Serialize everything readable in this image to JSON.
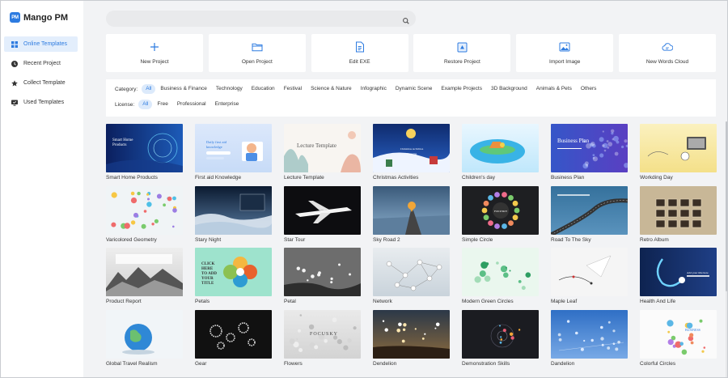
{
  "app": {
    "logo_badge": "PM",
    "name": "Mango PM",
    "accent": "#2d7be0"
  },
  "sidebar": {
    "items": [
      {
        "label": "Online Templates",
        "icon": "grid-icon",
        "active": true
      },
      {
        "label": "Recent Project",
        "icon": "clock-icon",
        "active": false
      },
      {
        "label": "Collect Template",
        "icon": "star-icon",
        "active": false
      },
      {
        "label": "Used Templates",
        "icon": "monitor-icon",
        "active": false
      }
    ]
  },
  "search": {
    "placeholder": "",
    "icon": "search-icon"
  },
  "actions": [
    {
      "label": "New Project",
      "icon": "plus-icon"
    },
    {
      "label": "Open Project",
      "icon": "folder-icon"
    },
    {
      "label": "Edit EXE",
      "icon": "exe-file-icon"
    },
    {
      "label": "Restore Project",
      "icon": "restore-icon"
    },
    {
      "label": "Import Image",
      "icon": "image-icon"
    },
    {
      "label": "New Words Cloud",
      "icon": "cloud-icon"
    }
  ],
  "filters": {
    "category_label": "Category:",
    "categories": [
      "All",
      "Business & Finance",
      "Technology",
      "Education",
      "Festival",
      "Science & Nature",
      "Infographic",
      "Dynamic Scene",
      "Example Projects",
      "3D Background",
      "Animals & Pets",
      "Others"
    ],
    "category_selected": "All",
    "license_label": "License:",
    "licenses": [
      "All",
      "Free",
      "Professional",
      "Enterprise"
    ],
    "license_selected": "All"
  },
  "templates": [
    {
      "name": "Smart Home Products",
      "style": "smart-home",
      "caption": "Smart Home Products"
    },
    {
      "name": "First aid Knowledge",
      "style": "first-aid",
      "caption": "Daily first aid knowledge"
    },
    {
      "name": "Lecture Template",
      "style": "lecture",
      "caption": "Lecture Template"
    },
    {
      "name": "Christmas Activities",
      "style": "christmas",
      "caption": "Christmas Activities Planning"
    },
    {
      "name": "Children's day",
      "style": "children",
      "caption": ""
    },
    {
      "name": "Business Plan",
      "style": "business",
      "caption": "Business Plan"
    },
    {
      "name": "Workding Day",
      "style": "workday",
      "caption": ""
    },
    {
      "name": "Varicolored Geometry",
      "style": "geometry",
      "caption": ""
    },
    {
      "name": "Stary Night",
      "style": "stary",
      "caption": ""
    },
    {
      "name": "Star Tour",
      "style": "startour",
      "caption": ""
    },
    {
      "name": "Sky Road 2",
      "style": "skyroad",
      "caption": ""
    },
    {
      "name": "Simple Circle",
      "style": "circle",
      "caption": "FOCUSKY"
    },
    {
      "name": "Road To The Sky",
      "style": "roadsky",
      "caption": ""
    },
    {
      "name": "Retro Album",
      "style": "retro",
      "caption": ""
    },
    {
      "name": "Product Report",
      "style": "report",
      "caption": ""
    },
    {
      "name": "Petals",
      "style": "petals",
      "caption": "CLICK HERE TO ADD YOUR TITLE"
    },
    {
      "name": "Petal",
      "style": "petal",
      "caption": ""
    },
    {
      "name": "Network",
      "style": "network",
      "caption": ""
    },
    {
      "name": "Modern Green Circles",
      "style": "green",
      "caption": ""
    },
    {
      "name": "Maple Leaf",
      "style": "maple",
      "caption": ""
    },
    {
      "name": "Health And Life",
      "style": "health",
      "caption": "Add your title here"
    },
    {
      "name": "Global Travel Realism",
      "style": "travel",
      "caption": ""
    },
    {
      "name": "Gear",
      "style": "gear",
      "caption": ""
    },
    {
      "name": "Flowers",
      "style": "flowers",
      "caption": "FOCUSKY"
    },
    {
      "name": "Dendelion",
      "style": "dendelion",
      "caption": ""
    },
    {
      "name": "Demonstration Skills",
      "style": "demo",
      "caption": ""
    },
    {
      "name": "Dandelion",
      "style": "dandelion",
      "caption": ""
    },
    {
      "name": "Colorful Circles",
      "style": "colorful",
      "caption": "BUSINESS"
    }
  ]
}
